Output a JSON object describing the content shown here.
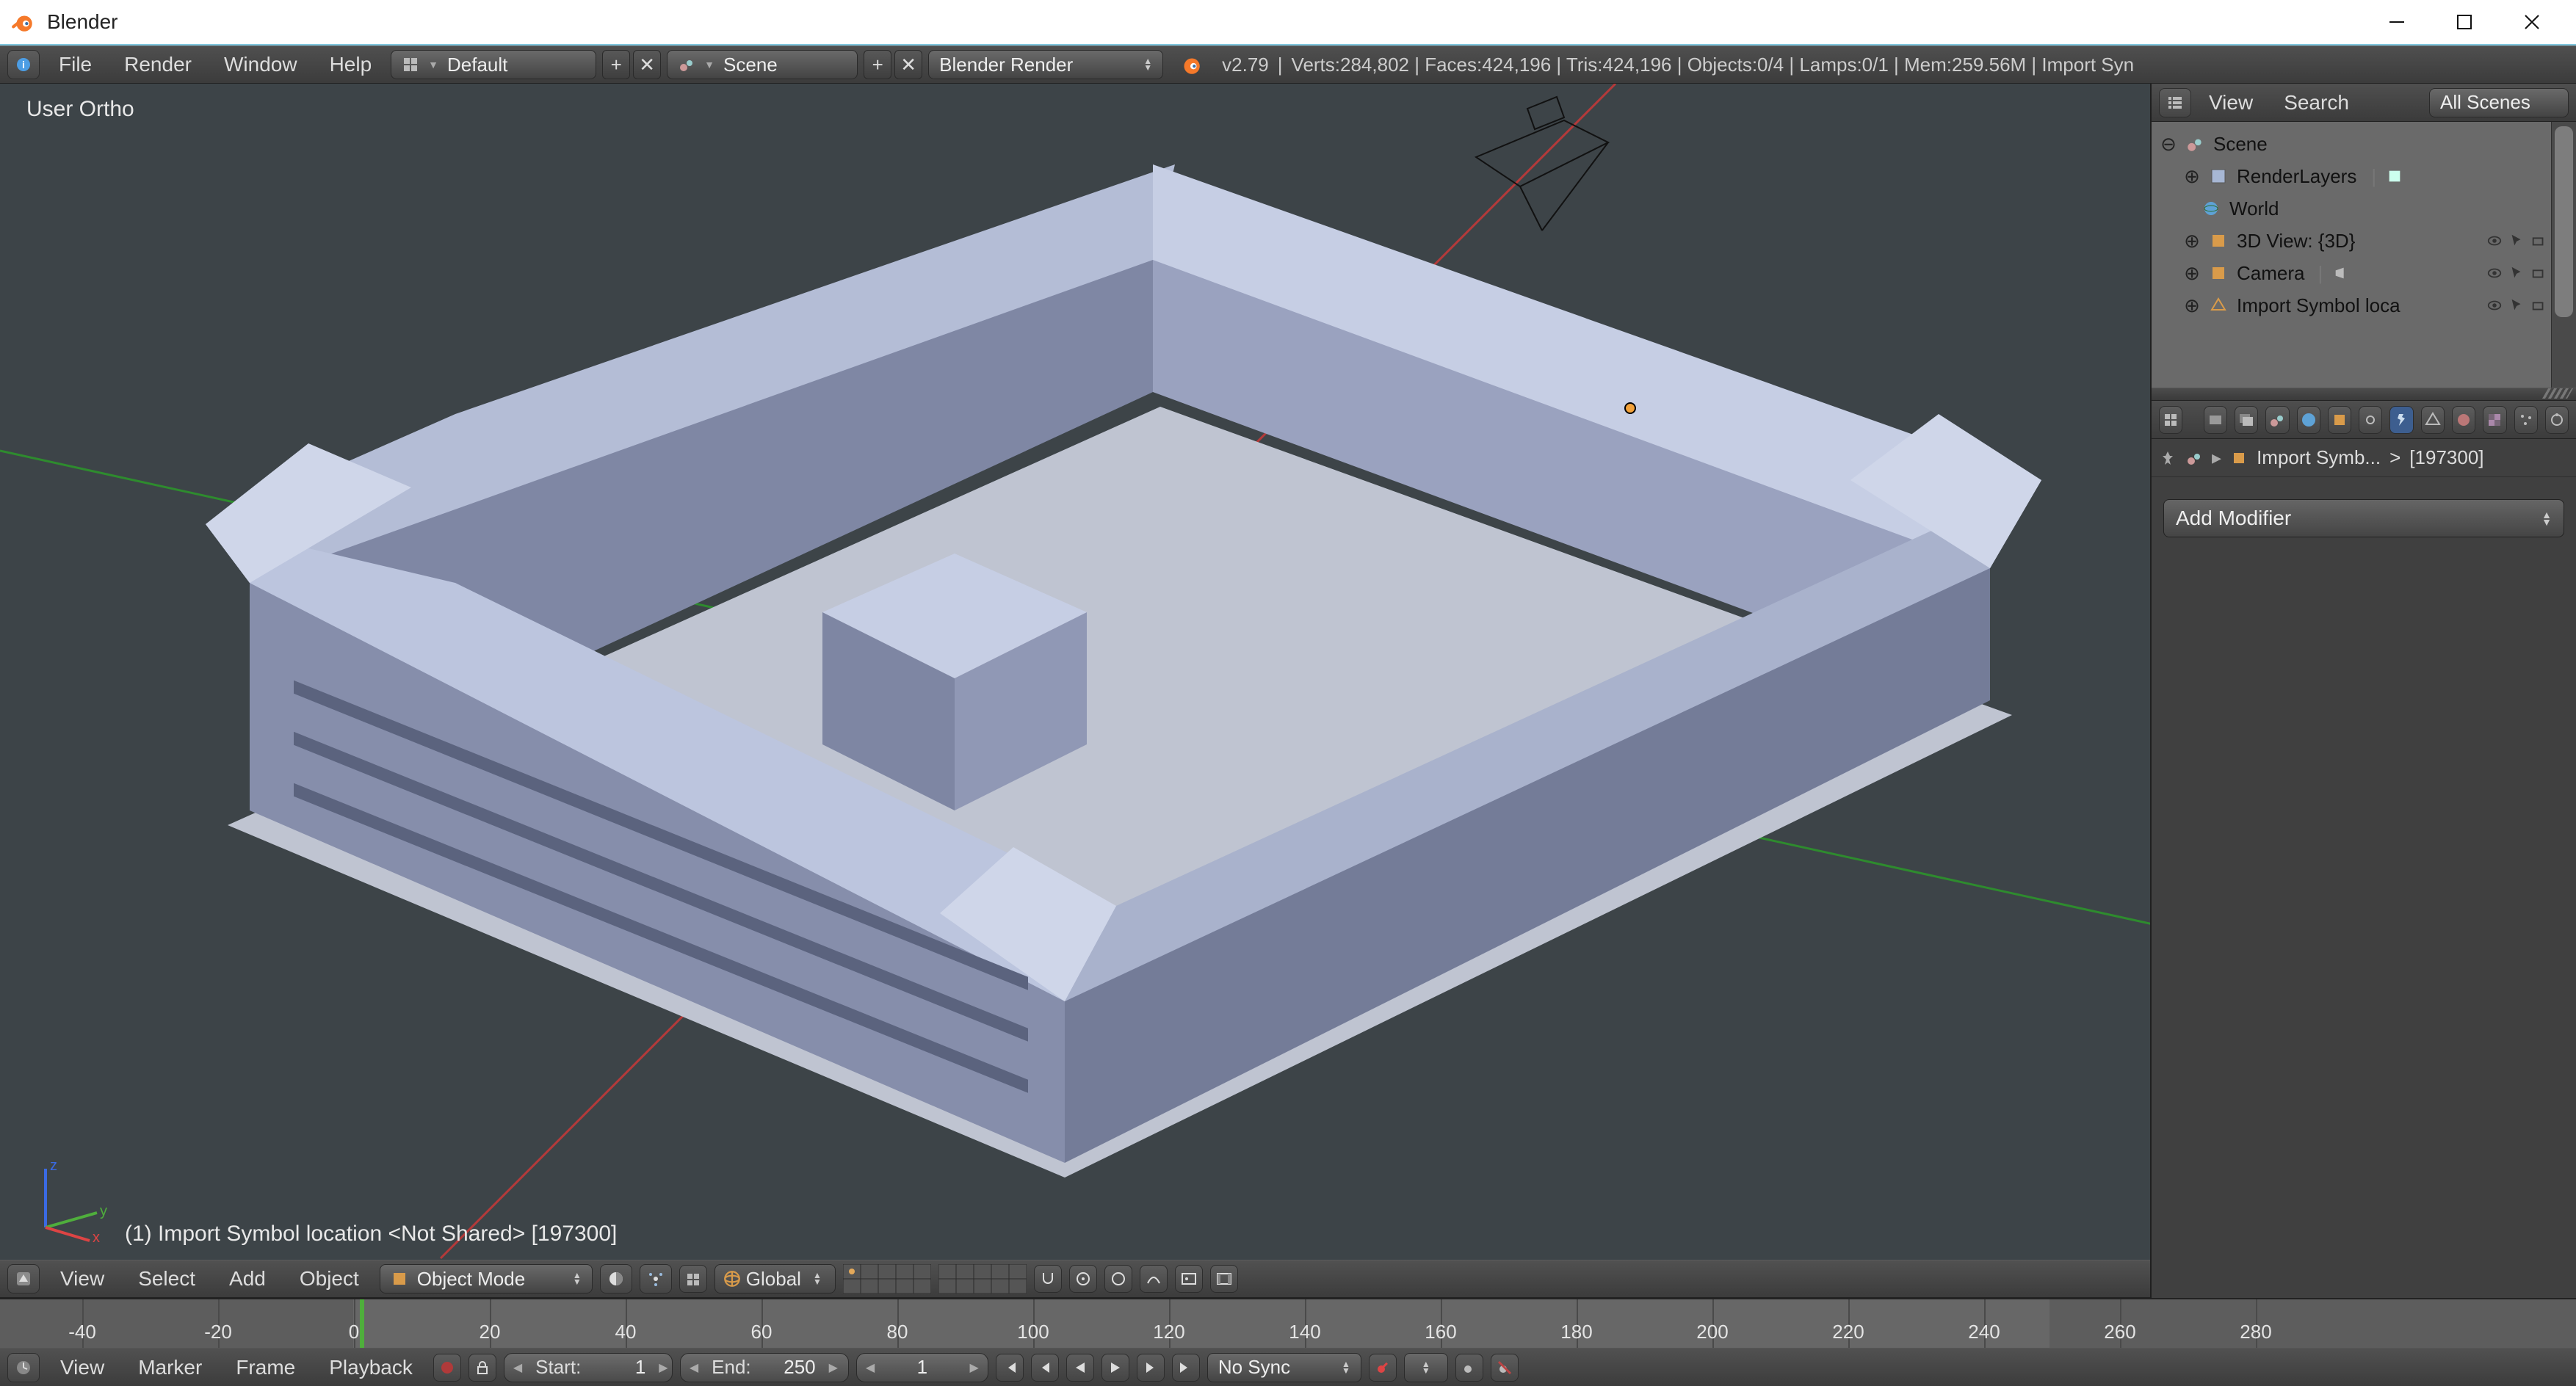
{
  "window": {
    "title": "Blender"
  },
  "topbar": {
    "menus": [
      "File",
      "Render",
      "Window",
      "Help"
    ],
    "layout_name": "Default",
    "scene_name": "Scene",
    "engine": "Blender Render",
    "version_prefix": "v2.79",
    "stats": "Verts:284,802 | Faces:424,196 | Tris:424,196 | Objects:0/4 | Lamps:0/1 | Mem:259.56M | Import Syn"
  },
  "viewport": {
    "top_label": "User Ortho",
    "bot_label": "(1) Import Symbol location <Not Shared> [197300]",
    "header_menus": [
      "View",
      "Select",
      "Add",
      "Object"
    ],
    "mode_label": "Object Mode",
    "orientation": "Global"
  },
  "outliner": {
    "menus": [
      "View",
      "Search"
    ],
    "filter": "All Scenes",
    "tree": {
      "scene": "Scene",
      "renderlayers": "RenderLayers",
      "world": "World",
      "view3d": "3D View: {3D}",
      "camera": "Camera",
      "import_symbol": "Import Symbol loca"
    }
  },
  "properties": {
    "crumb_obj": "Import Symb...",
    "crumb_id": "[197300]",
    "crumb_sep": ">",
    "add_modifier": "Add Modifier"
  },
  "timeline": {
    "menus": [
      "View",
      "Marker",
      "Frame",
      "Playback"
    ],
    "start_label": "Start:",
    "start_val": "1",
    "end_label": "End:",
    "end_val": "250",
    "cur_val": "1",
    "sync": "No Sync",
    "ticks": [
      "-40",
      "-20",
      "0",
      "20",
      "40",
      "60",
      "80",
      "100",
      "120",
      "140",
      "160",
      "180",
      "200",
      "220",
      "240",
      "260",
      "280"
    ]
  }
}
